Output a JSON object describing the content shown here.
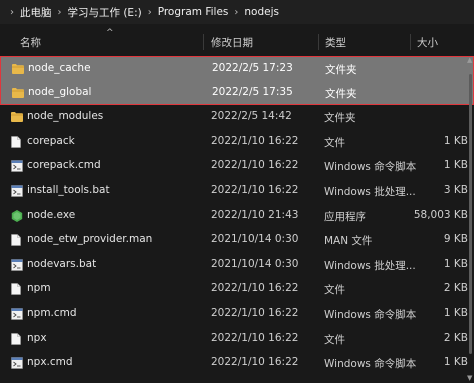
{
  "breadcrumb": [
    "此电脑",
    "学习与工作 (E:)",
    "Program Files",
    "nodejs"
  ],
  "columns": {
    "name": "名称",
    "date": "修改日期",
    "type": "类型",
    "size": "大小"
  },
  "files": [
    {
      "name": "node_cache",
      "date": "2022/2/5 17:23",
      "type": "文件夹",
      "size": "",
      "icon": "folder-icon",
      "selected": true
    },
    {
      "name": "node_global",
      "date": "2022/2/5 17:35",
      "type": "文件夹",
      "size": "",
      "icon": "folder-icon",
      "selected": true
    },
    {
      "name": "node_modules",
      "date": "2022/2/5 14:42",
      "type": "文件夹",
      "size": "",
      "icon": "folder-icon"
    },
    {
      "name": "corepack",
      "date": "2022/1/10 16:22",
      "type": "文件",
      "size": "1 KB",
      "icon": "file-icon"
    },
    {
      "name": "corepack.cmd",
      "date": "2022/1/10 16:22",
      "type": "Windows 命令脚本",
      "size": "1 KB",
      "icon": "script-icon"
    },
    {
      "name": "install_tools.bat",
      "date": "2022/1/10 16:22",
      "type": "Windows 批处理...",
      "size": "3 KB",
      "icon": "script-icon"
    },
    {
      "name": "node.exe",
      "date": "2022/1/10 21:43",
      "type": "应用程序",
      "size": "58,003 KB",
      "icon": "node-exe-icon"
    },
    {
      "name": "node_etw_provider.man",
      "date": "2021/10/14 0:30",
      "type": "MAN 文件",
      "size": "9 KB",
      "icon": "file-icon"
    },
    {
      "name": "nodevars.bat",
      "date": "2021/10/14 0:30",
      "type": "Windows 批处理...",
      "size": "1 KB",
      "icon": "script-icon"
    },
    {
      "name": "npm",
      "date": "2022/1/10 16:22",
      "type": "文件",
      "size": "2 KB",
      "icon": "file-icon"
    },
    {
      "name": "npm.cmd",
      "date": "2022/1/10 16:22",
      "type": "Windows 命令脚本",
      "size": "1 KB",
      "icon": "script-icon"
    },
    {
      "name": "npx",
      "date": "2022/1/10 16:22",
      "type": "文件",
      "size": "2 KB",
      "icon": "file-icon"
    },
    {
      "name": "npx.cmd",
      "date": "2022/1/10 16:22",
      "type": "Windows 命令脚本",
      "size": "1 KB",
      "icon": "script-icon"
    }
  ],
  "colors": {
    "background": "#191919",
    "selection": "#777777",
    "highlight_border": "#e0363c",
    "folder": "#e8b84a",
    "node_green": "#4caf50"
  }
}
